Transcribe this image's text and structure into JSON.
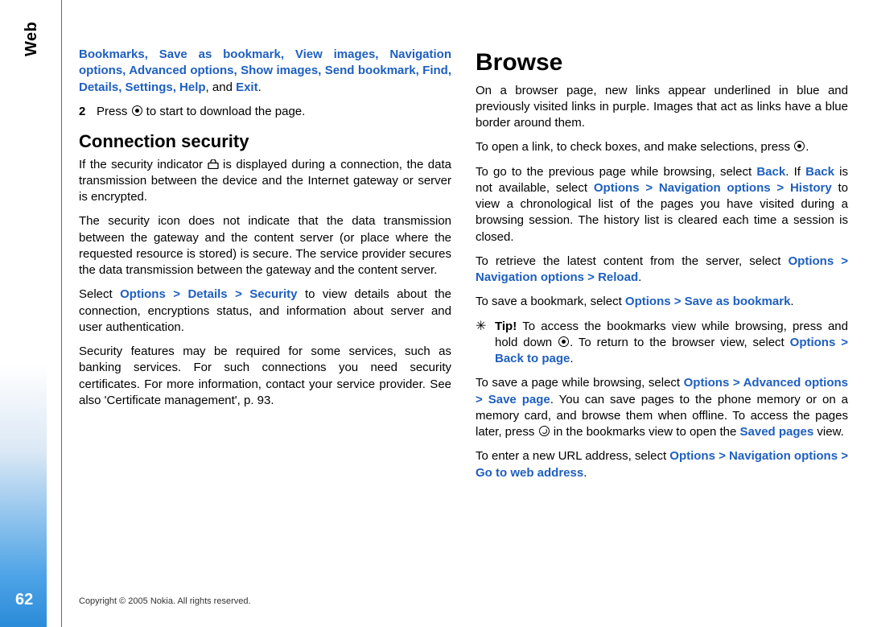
{
  "side_label": "Web",
  "page_number": "62",
  "footer": "Copyright © 2005 Nokia. All rights reserved.",
  "menu_list_items": [
    "Bookmarks",
    "Save as bookmark",
    "View images",
    "Navigation options",
    "Advanced options",
    "Show images",
    "Send bookmark",
    "Find",
    "Details",
    "Settings",
    "Help"
  ],
  "menu_list_and": ", and ",
  "menu_list_exit": "Exit",
  "step2_num": "2",
  "step2_a": "Press ",
  "step2_b": " to start to download the page.",
  "h_conn": "Connection security",
  "conn_p1a": "If the security indicator ",
  "conn_p1b": " is displayed during a connection, the data transmission between the device and the Internet gateway or server is encrypted.",
  "conn_p2": "The security icon does not indicate that the data transmission between the gateway and the content server (or place where the requested resource is stored) is secure. The service provider secures the data transmission between the gateway and the content server.",
  "conn_p3a": "Select ",
  "conn_p3_path": "Options > Details > Security",
  "conn_p3b": " to view details about the connection, encryptions status, and information about server and user authentication.",
  "conn_p4": "Security features may be required for some services, such as banking services. For such connections you need security certificates. For more information, contact your service provider. See also 'Certificate management', p. 93.",
  "h_browse": "Browse",
  "browse_p1": "On a browser page, new links appear underlined in blue and previously visited links in purple. Images that act as links have a blue border around them.",
  "browse_p2a": "To open a link, to check boxes, and make selections, press ",
  "browse_p2b": ".",
  "browse_p3a": "To go to the previous page while browsing, select ",
  "browse_p3_back": "Back",
  "browse_p3b": ". If ",
  "browse_p3c": " is not available, select ",
  "browse_p3_path1": "Options > Navigation options > History",
  "browse_p3d": " to view a chronological list of the pages you have visited during a browsing session. The history list is cleared each time a session is closed.",
  "browse_p4a": "To retrieve the latest content from the server, select ",
  "browse_p4_path": "Options > Navigation options > Reload",
  "browse_p4b": ".",
  "browse_p5a": "To save a bookmark, select ",
  "browse_p5_path": "Options > Save as bookmark",
  "browse_p5b": ".",
  "tip_label": "Tip!",
  "tip_a": " To access the bookmarks view while browsing, press and hold down ",
  "tip_b": ". To return to the browser view, select ",
  "tip_path": "Options > Back to page",
  "tip_c": ".",
  "browse_p6a": "To save a page while browsing, select ",
  "browse_p6_path": "Options > Advanced options > Save page",
  "browse_p6b": ". You can save pages to the phone memory or on a memory card, and browse them when offline. To access the pages later, press ",
  "browse_p6c": " in the bookmarks view to open the ",
  "browse_p6_saved": "Saved pages",
  "browse_p6d": " view.",
  "browse_p7a": "To enter a new URL address, select ",
  "browse_p7_path": "Options > Navigation options > Go to web address",
  "browse_p7b": "."
}
